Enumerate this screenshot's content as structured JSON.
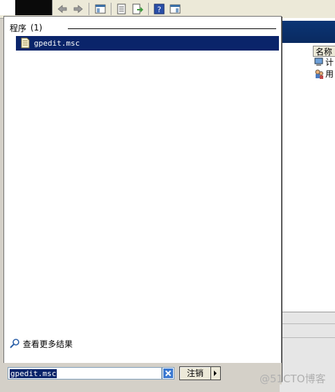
{
  "start_menu": {
    "group_header_label": "程序",
    "group_header_count": "(1)",
    "result_item_label": "gpedit.msc",
    "more_results_label": "查看更多结果"
  },
  "search": {
    "value": "gpedit.msc"
  },
  "logoff_button_label": "注销",
  "background_window": {
    "column_header": "名称",
    "rows": [
      "计",
      "用"
    ]
  },
  "watermark": "@51CTO博客",
  "icons": {
    "result_item": "document-icon",
    "more_results": "search-icon",
    "clear_search": "close-icon",
    "logoff_menu": "chevron-right-icon"
  },
  "colors": {
    "selection": "#0a246a",
    "panel_background": "#ffffff",
    "chrome": "#d4d0c8"
  }
}
